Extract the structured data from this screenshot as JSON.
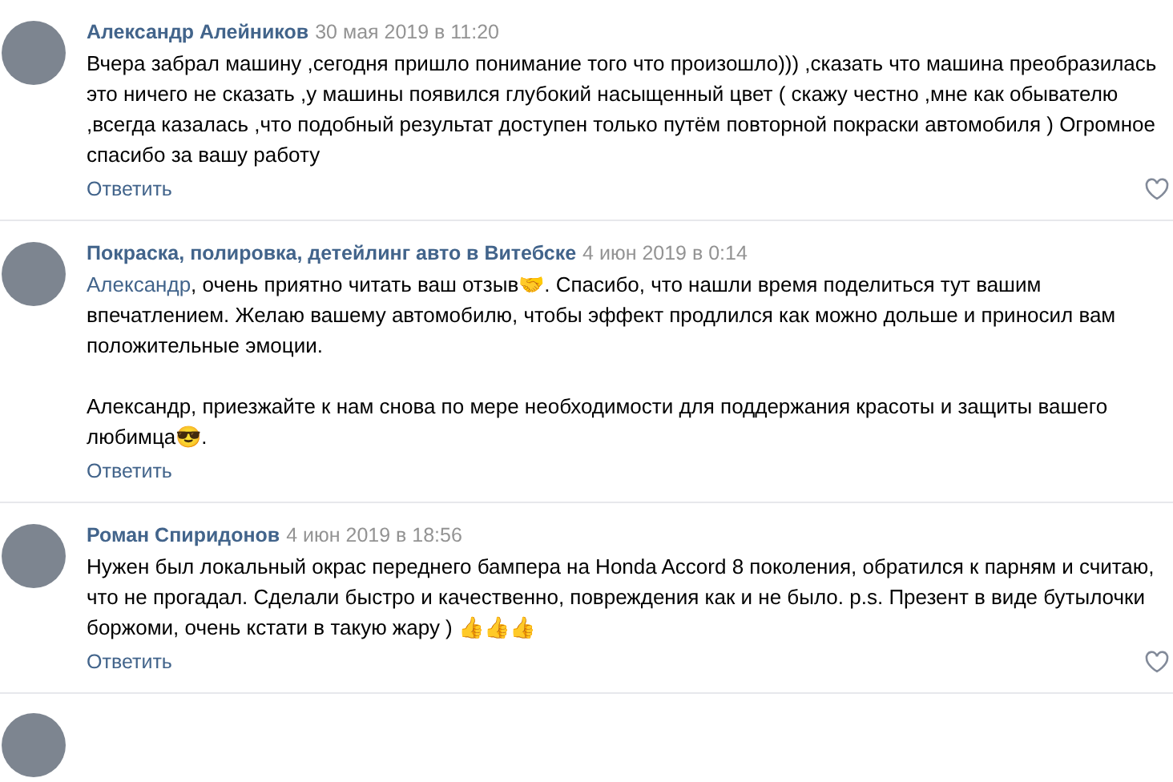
{
  "comments": [
    {
      "author": "Александр Алейников",
      "date": "30 мая 2019 в 11:20",
      "paragraphs": [
        [
          {
            "kind": "text",
            "text": "Вчера забрал машину ,сегодня пришло понимание того что произошло))) ,сказать что машина преобразилась это ничего не сказать ,у машины появился глубокий насыщенный цвет ( скажу честно ,мне как обывателю ,всегда казалась ,что подобный результат доступен только путём повторной покраски автомобиля ) Огромное спасибо за вашу работу"
          }
        ]
      ],
      "reply": "Ответить",
      "like": true
    },
    {
      "author": "Покраска, полировка, детейлинг авто в Витебске",
      "date": "4 июн 2019 в 0:14",
      "paragraphs": [
        [
          {
            "kind": "mention",
            "text": "Александр"
          },
          {
            "kind": "text",
            "text": ", очень приятно читать ваш отзыв"
          },
          {
            "kind": "emoji",
            "text": "🤝"
          },
          {
            "kind": "text",
            "text": ". Спасибо, что нашли время поделиться тут вашим впечатлением. Желаю вашему автомобилю, чтобы эффект продлился как можно дольше и приносил вам положительные эмоции."
          }
        ],
        [
          {
            "kind": "text",
            "text": "Александр, приезжайте к нам снова по мере необходимости для поддержания красоты и защиты вашего любимца"
          },
          {
            "kind": "emoji",
            "text": "😎"
          },
          {
            "kind": "text",
            "text": "."
          }
        ]
      ],
      "reply": "Ответить",
      "like": false
    },
    {
      "author": "Роман Спиридонов",
      "date": "4 июн 2019 в 18:56",
      "paragraphs": [
        [
          {
            "kind": "text",
            "text": "Нужен был локальный окрас переднего бампера на Honda Accord 8 поколения, обратился к парням и считаю, что не прогадал. Сделали быстро и качественно, повреждения как и не было. p.s. Презент в виде бутылочки боржоми, очень кстати в такую жару ) "
          },
          {
            "kind": "emoji",
            "text": "👍👍👍"
          }
        ]
      ],
      "reply": "Ответить",
      "like": true
    }
  ],
  "next_comment_avatar": true
}
